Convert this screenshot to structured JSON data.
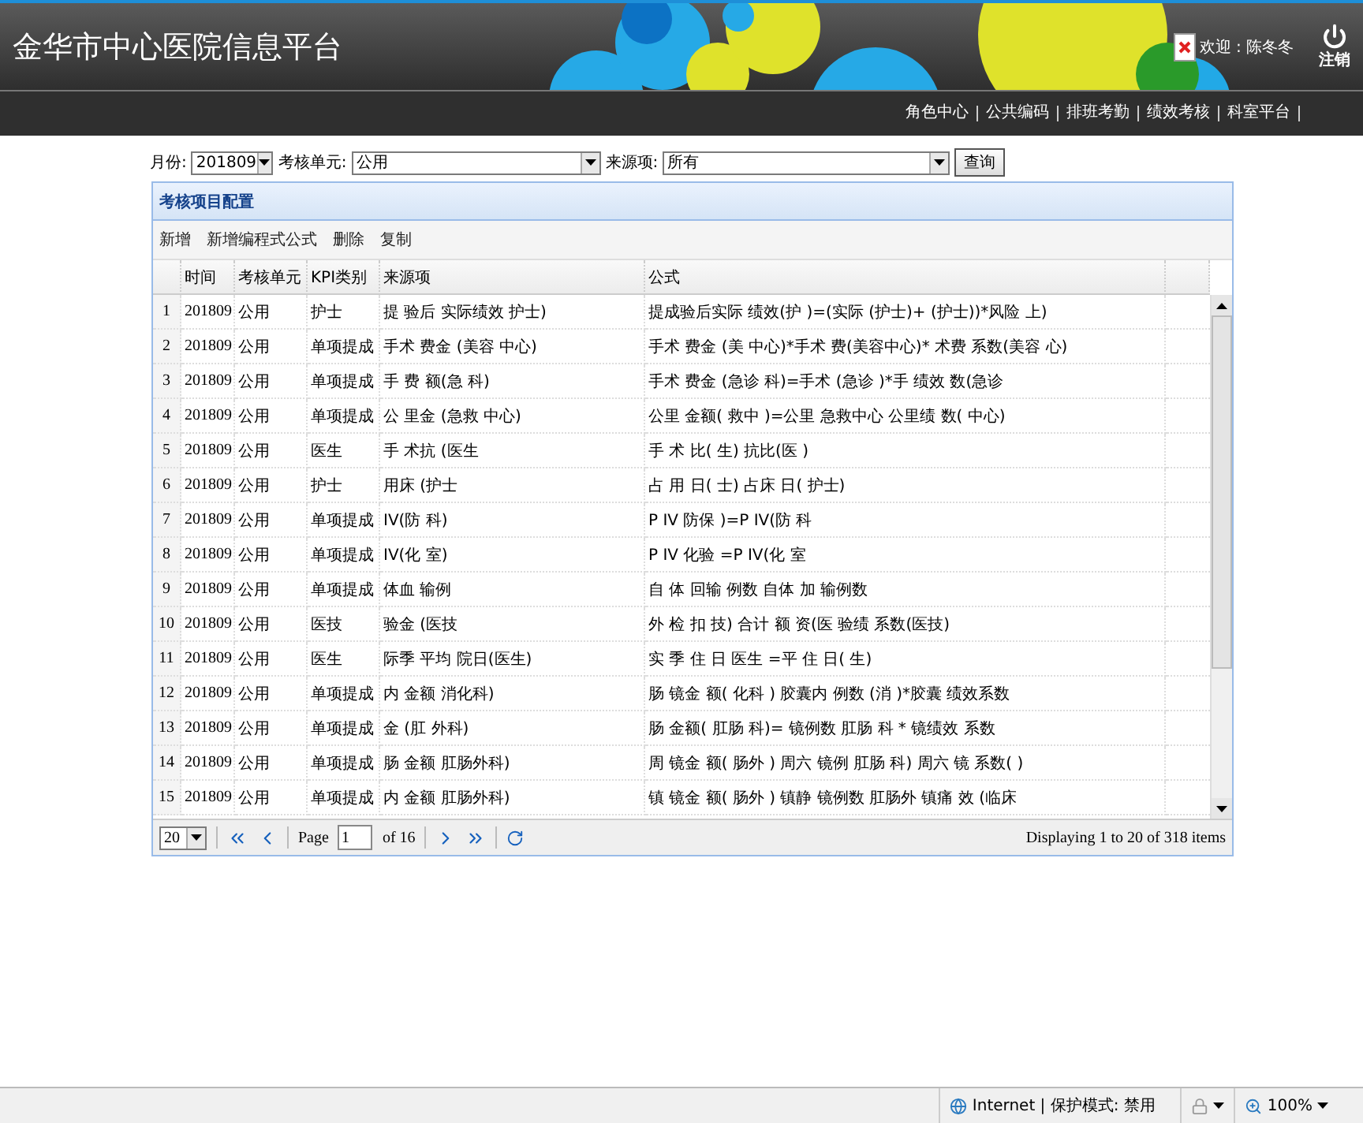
{
  "header": {
    "title": "金华市中心医院信息平台",
    "welcome": "欢迎 : 陈冬冬",
    "logout": "注销"
  },
  "nav": [
    "角色中心",
    "公共编码",
    "排班考勤",
    "绩效考核",
    "科室平台"
  ],
  "filters": {
    "month_label": "月份:",
    "month": "201809",
    "unit_label": "考核单元:",
    "unit": "公用",
    "source_label": "来源项:",
    "source": "所有",
    "query": "查询"
  },
  "panel": {
    "title": "考核项目配置",
    "actions": [
      "新增",
      "新增编程式公式",
      "删除",
      "复制"
    ],
    "columns": [
      "时间",
      "考核单元",
      "KPI类别",
      "来源项",
      "公式"
    ],
    "rows": [
      {
        "number": "1",
        "time": "201809",
        "unit": "公用",
        "kpi": "护士",
        "source": "提  验后  实际绩效  护士)",
        "formula": "提成验后实际  绩效(护  )=(实际  (护士)+  (护士))*风险  上)"
      },
      {
        "number": "2",
        "time": "201809",
        "unit": "公用",
        "kpi": "单项提成",
        "source": "手术  费金  (美容  中心)",
        "formula": "手术  费金  (美  中心)*手术  费(美容中心)*  术费  系数(美容  心)"
      },
      {
        "number": "3",
        "time": "201809",
        "unit": "公用",
        "kpi": "单项提成",
        "source": "手  费  额(急  科)",
        "formula": "手术  费金  (急诊  科)=手术  (急诊  )*手  绩效  数(急诊"
      },
      {
        "number": "4",
        "time": "201809",
        "unit": "公用",
        "kpi": "单项提成",
        "source": "公  里金  (急救  中心)",
        "formula": "公里  金额(  救中  )=公里  急救中心  公里绩  数(  中心)"
      },
      {
        "number": "5",
        "time": "201809",
        "unit": "公用",
        "kpi": "医生",
        "source": "手  术抗  (医生",
        "formula": "手  术  比(  生)  抗比(医  )"
      },
      {
        "number": "6",
        "time": "201809",
        "unit": "公用",
        "kpi": "护士",
        "source": "  用床  (护士",
        "formula": "占  用  日(  士)  占床  日(  护士)"
      },
      {
        "number": "7",
        "time": "201809",
        "unit": "公用",
        "kpi": "单项提成",
        "source": "  IV(防  科)",
        "formula": "P  IV  防保  )=P  IV(防  科"
      },
      {
        "number": "8",
        "time": "201809",
        "unit": "公用",
        "kpi": "单项提成",
        "source": "  IV(化  室)",
        "formula": "P  IV  化验  =P  IV(化  室"
      },
      {
        "number": "9",
        "time": "201809",
        "unit": "公用",
        "kpi": "单项提成",
        "source": "  体血  输例  ",
        "formula": "自  体  回输  例数  自体  加  输例数"
      },
      {
        "number": "10",
        "time": "201809",
        "unit": "公用",
        "kpi": "医技",
        "source": "  验金  (医技",
        "formula": "外  检  扣  技)  合计  额  资(医  验绩  系数(医技)"
      },
      {
        "number": "11",
        "time": "201809",
        "unit": "公用",
        "kpi": "医生",
        "source": "  际季  平均  院日(医生)",
        "formula": "实  季  住  日  医生  =平  住  日(  生)"
      },
      {
        "number": "12",
        "time": "201809",
        "unit": "公用",
        "kpi": "单项提成",
        "source": "  内  金额  消化科)",
        "formula": "肠  镜金  额(  化科  )  胶囊内  例数  (消  )*胶囊  绩效系数"
      },
      {
        "number": "13",
        "time": "201809",
        "unit": "公用",
        "kpi": "单项提成",
        "source": "  金  (肛  外科)",
        "formula": "肠  金额(  肛肠  科)=  镜例数  肛肠  科  *  镜绩效  系数"
      },
      {
        "number": "14",
        "time": "201809",
        "unit": "公用",
        "kpi": "单项提成",
        "source": "  肠  金额  肛肠外科)",
        "formula": "周  镜金  额(  肠外  )  周六  镜例  肛肠  科)  周六  镜  系数(  )"
      },
      {
        "number": "15",
        "time": "201809",
        "unit": "公用",
        "kpi": "单项提成",
        "source": "  内  金额  肛肠外科)",
        "formula": "镇  镜金  额(  肠外  )  镇静  镜例数  肛肠外  镇痛  效  (临床"
      }
    ]
  },
  "pager": {
    "page_size": "20",
    "page_label": "Page",
    "page": "1",
    "of": "of 16",
    "summary": "Displaying 1 to 20 of 318 items"
  },
  "status_bar": {
    "zone": "Internet | 保护模式: 禁用",
    "zoom": "100%"
  }
}
